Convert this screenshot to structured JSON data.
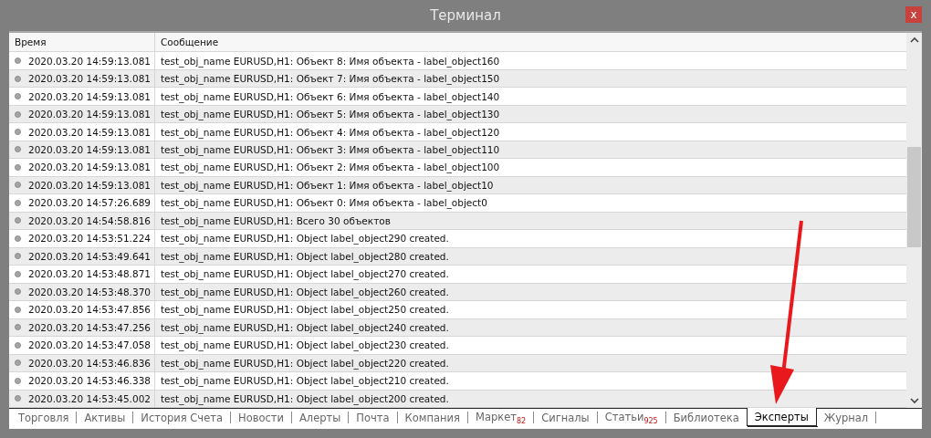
{
  "window": {
    "title": "Терминал",
    "close": "x"
  },
  "table": {
    "columns": [
      "Время",
      "Сообщение"
    ],
    "rows": [
      {
        "time": "2020.03.20 14:59:13.081",
        "message": "test_obj_name EURUSD,H1: Объект 8: Имя объекта - label_object160"
      },
      {
        "time": "2020.03.20 14:59:13.081",
        "message": "test_obj_name EURUSD,H1: Объект 7: Имя объекта - label_object150"
      },
      {
        "time": "2020.03.20 14:59:13.081",
        "message": "test_obj_name EURUSD,H1: Объект 6: Имя объекта - label_object140"
      },
      {
        "time": "2020.03.20 14:59:13.081",
        "message": "test_obj_name EURUSD,H1: Объект 5: Имя объекта - label_object130"
      },
      {
        "time": "2020.03.20 14:59:13.081",
        "message": "test_obj_name EURUSD,H1: Объект 4: Имя объекта - label_object120"
      },
      {
        "time": "2020.03.20 14:59:13.081",
        "message": "test_obj_name EURUSD,H1: Объект 3: Имя объекта - label_object110"
      },
      {
        "time": "2020.03.20 14:59:13.081",
        "message": "test_obj_name EURUSD,H1: Объект 2: Имя объекта - label_object100"
      },
      {
        "time": "2020.03.20 14:59:13.081",
        "message": "test_obj_name EURUSD,H1: Объект 1: Имя объекта - label_object10"
      },
      {
        "time": "2020.03.20 14:57:26.689",
        "message": "test_obj_name EURUSD,H1: Объект 0: Имя объекта - label_object0"
      },
      {
        "time": "2020.03.20 14:54:58.816",
        "message": "test_obj_name EURUSD,H1: Всего 30 объектов"
      },
      {
        "time": "2020.03.20 14:53:51.224",
        "message": "test_obj_name EURUSD,H1: Object label_object290 created."
      },
      {
        "time": "2020.03.20 14:53:49.641",
        "message": "test_obj_name EURUSD,H1: Object label_object280 created."
      },
      {
        "time": "2020.03.20 14:53:48.871",
        "message": "test_obj_name EURUSD,H1: Object label_object270 created."
      },
      {
        "time": "2020.03.20 14:53:48.370",
        "message": "test_obj_name EURUSD,H1: Object label_object260 created."
      },
      {
        "time": "2020.03.20 14:53:47.856",
        "message": "test_obj_name EURUSD,H1: Object label_object250 created."
      },
      {
        "time": "2020.03.20 14:53:47.256",
        "message": "test_obj_name EURUSD,H1: Object label_object240 created."
      },
      {
        "time": "2020.03.20 14:53:47.058",
        "message": "test_obj_name EURUSD,H1: Object label_object230 created."
      },
      {
        "time": "2020.03.20 14:53:46.836",
        "message": "test_obj_name EURUSD,H1: Object label_object220 created."
      },
      {
        "time": "2020.03.20 14:53:46.338",
        "message": "test_obj_name EURUSD,H1: Object label_object210 created."
      },
      {
        "time": "2020.03.20 14:53:45.002",
        "message": "test_obj_name EURUSD,H1: Object label_object200 created."
      }
    ]
  },
  "tabs": [
    {
      "label": "Торговля",
      "selected": false
    },
    {
      "label": "Активы",
      "selected": false
    },
    {
      "label": "История Счета",
      "selected": false
    },
    {
      "label": "Новости",
      "selected": false
    },
    {
      "label": "Алерты",
      "selected": false
    },
    {
      "label": "Почта",
      "selected": false
    },
    {
      "label": "Компания",
      "selected": false
    },
    {
      "label": "Маркет",
      "badge": "82",
      "selected": false
    },
    {
      "label": "Сигналы",
      "selected": false
    },
    {
      "label": "Статьи",
      "badge": "925",
      "selected": false
    },
    {
      "label": "Библиотека",
      "selected": false
    },
    {
      "label": "Эксперты",
      "selected": true
    },
    {
      "label": "Журнал",
      "selected": false
    }
  ]
}
